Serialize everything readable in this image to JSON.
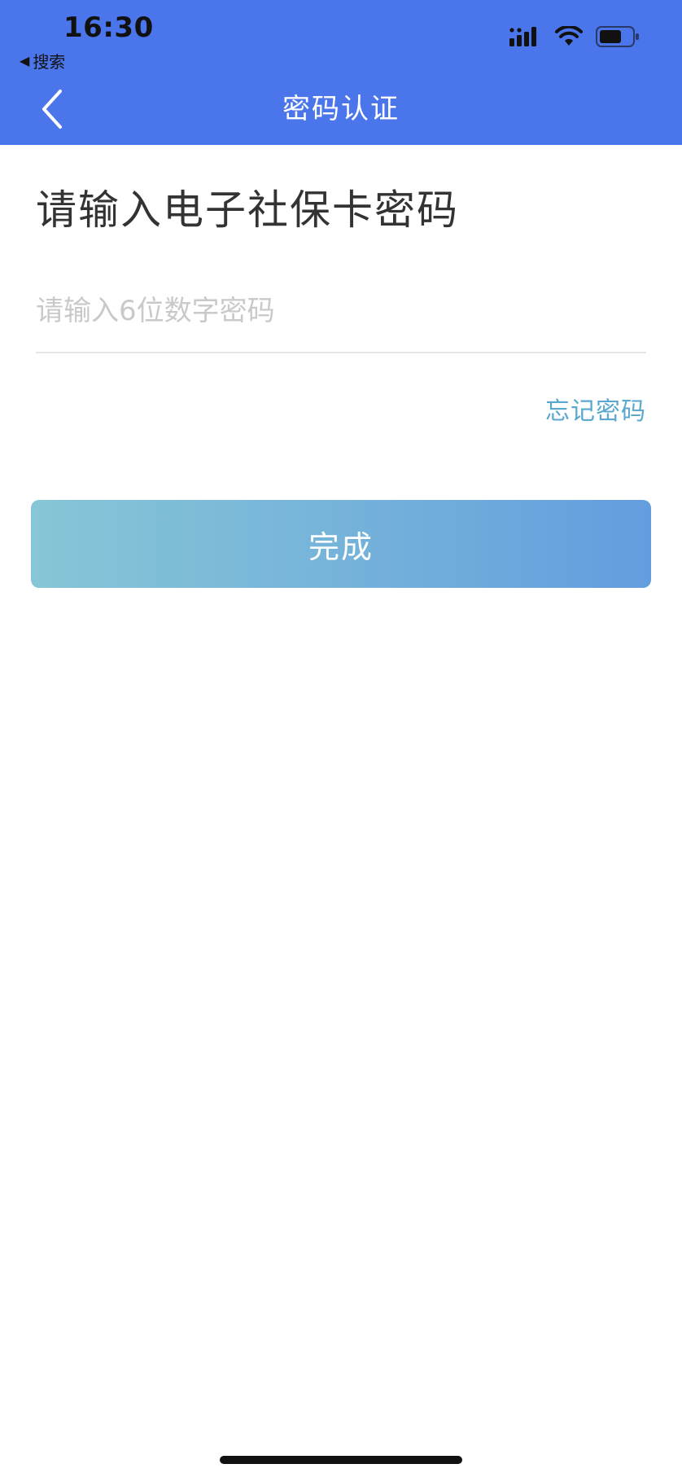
{
  "status_bar": {
    "time": "16:30",
    "back_app_label": "搜索",
    "back_arrow": "◀"
  },
  "nav": {
    "title": "密码认证",
    "back_icon": "chevron-left-icon"
  },
  "main": {
    "heading": "请输入电子社保卡密码",
    "password_placeholder": "请输入6位数字密码",
    "password_value": "",
    "forgot_label": "忘记密码",
    "done_label": "完成"
  },
  "colors": {
    "header_bg": "#4b76eb",
    "link": "#5aa7cf",
    "button_gradient_start": "#86c6d6",
    "button_gradient_end": "#639ddf"
  }
}
